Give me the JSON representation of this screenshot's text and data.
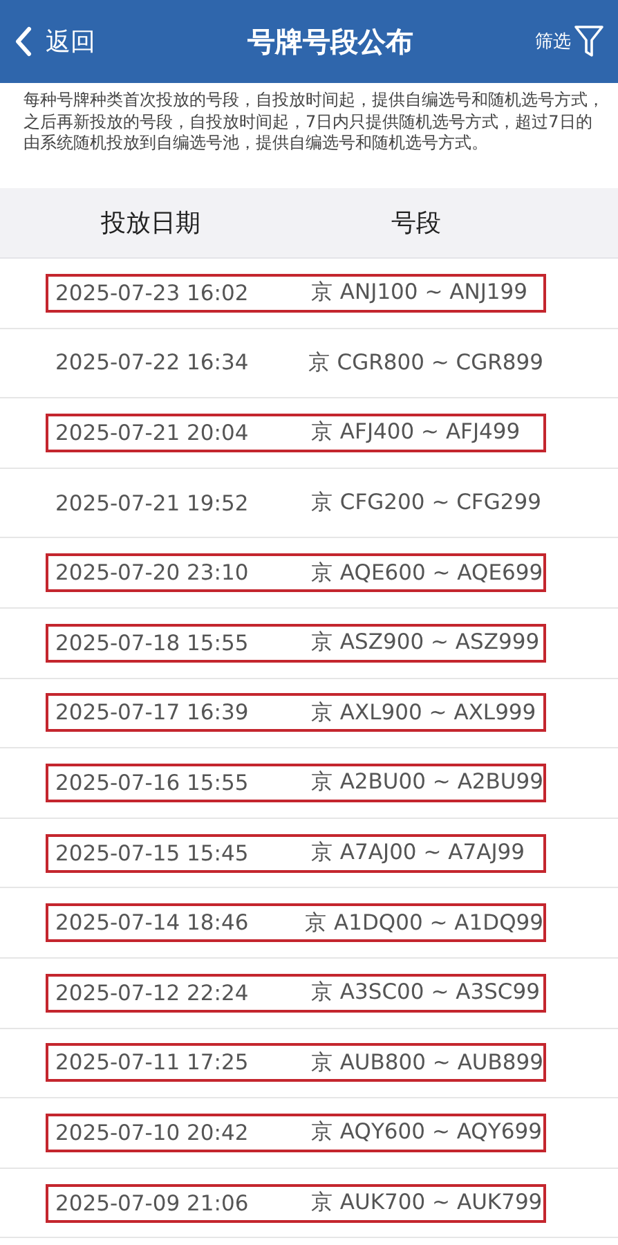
{
  "header": {
    "back": "返回",
    "title": "号牌号段公布",
    "filter": "筛选"
  },
  "notice": "每种号牌种类首次投放的号段，自投放时间起，提供自编选号和随机选号方式，之后再新投放的号段，自投放时间起，7日内只提供随机选号方式，超过7日的由系统随机投放到自编选号池，提供自编选号和随机选号方式。",
  "table": {
    "columns": [
      "投放日期",
      "号段"
    ],
    "rows": [
      {
        "date": "2025-07-23 16:02",
        "range": "京 ANJ100 ~ ANJ199",
        "highlighted": true
      },
      {
        "date": "2025-07-22 16:34",
        "range": "京 CGR800 ~ CGR899",
        "highlighted": false
      },
      {
        "date": "2025-07-21 20:04",
        "range": "京 AFJ400 ~ AFJ499",
        "highlighted": true
      },
      {
        "date": "2025-07-21 19:52",
        "range": "京 CFG200 ~ CFG299",
        "highlighted": false
      },
      {
        "date": "2025-07-20 23:10",
        "range": "京 AQE600 ~ AQE699",
        "highlighted": true
      },
      {
        "date": "2025-07-18 15:55",
        "range": "京 ASZ900 ~ ASZ999",
        "highlighted": true
      },
      {
        "date": "2025-07-17 16:39",
        "range": "京 AXL900 ~ AXL999",
        "highlighted": true
      },
      {
        "date": "2025-07-16 15:55",
        "range": "京 A2BU00 ~ A2BU99",
        "highlighted": true
      },
      {
        "date": "2025-07-15 15:45",
        "range": "京 A7AJ00 ~ A7AJ99",
        "highlighted": true
      },
      {
        "date": "2025-07-14 18:46",
        "range": "京 A1DQ00 ~ A1DQ99",
        "highlighted": true
      },
      {
        "date": "2025-07-12 22:24",
        "range": "京 A3SC00 ~ A3SC99",
        "highlighted": true
      },
      {
        "date": "2025-07-11 17:25",
        "range": "京 AUB800 ~ AUB899",
        "highlighted": true
      },
      {
        "date": "2025-07-10 20:42",
        "range": "京 AQY600 ~ AQY699",
        "highlighted": true
      },
      {
        "date": "2025-07-09 21:06",
        "range": "京 AUK700 ~ AUK799",
        "highlighted": true
      }
    ]
  }
}
